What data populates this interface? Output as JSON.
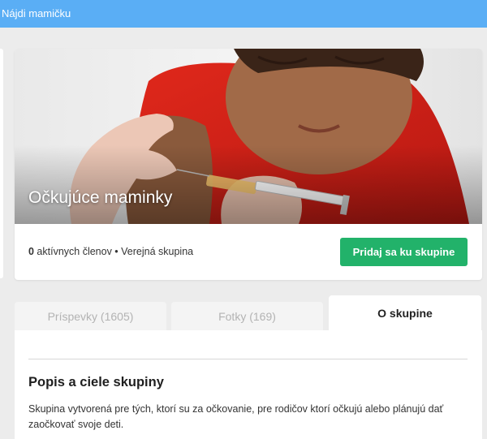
{
  "app": {
    "title": "Nájdi mamičku"
  },
  "group": {
    "name": "Očkujúce maminky",
    "members_count": "0",
    "members_text": " aktívnych členov • Verejná skupina",
    "join_label": "Pridaj sa ku skupine"
  },
  "tabs": [
    {
      "label": "Príspevky (1605)",
      "active": false
    },
    {
      "label": "Fotky (169)",
      "active": false
    },
    {
      "label": "O skupine",
      "active": true
    }
  ],
  "about": {
    "heading": "Popis a ciele skupiny",
    "description": "Skupina vytvorená pre tých, ktorí su za očkovanie, pre rodičov ktorí očkujú alebo plánujú dať zaočkovať svoje deti."
  },
  "colors": {
    "header": "#5aaef5",
    "join_button": "#22b26a",
    "page_bg": "#ececec"
  }
}
